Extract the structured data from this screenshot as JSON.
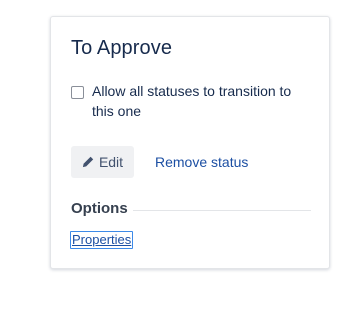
{
  "panel": {
    "title": "To Approve",
    "checkbox": {
      "label": "Allow all statuses to transition to this one",
      "checked": false
    },
    "actions": {
      "edit_label": "Edit",
      "remove_label": "Remove status"
    },
    "options": {
      "heading": "Options",
      "properties_label": "Properties"
    }
  },
  "icons": {
    "edit": "pencil-icon"
  },
  "colors": {
    "title": "#172b4d",
    "link": "#1c4fa3",
    "button_bg": "#f0f1f3",
    "focus_ring": "#3d8ae8"
  }
}
